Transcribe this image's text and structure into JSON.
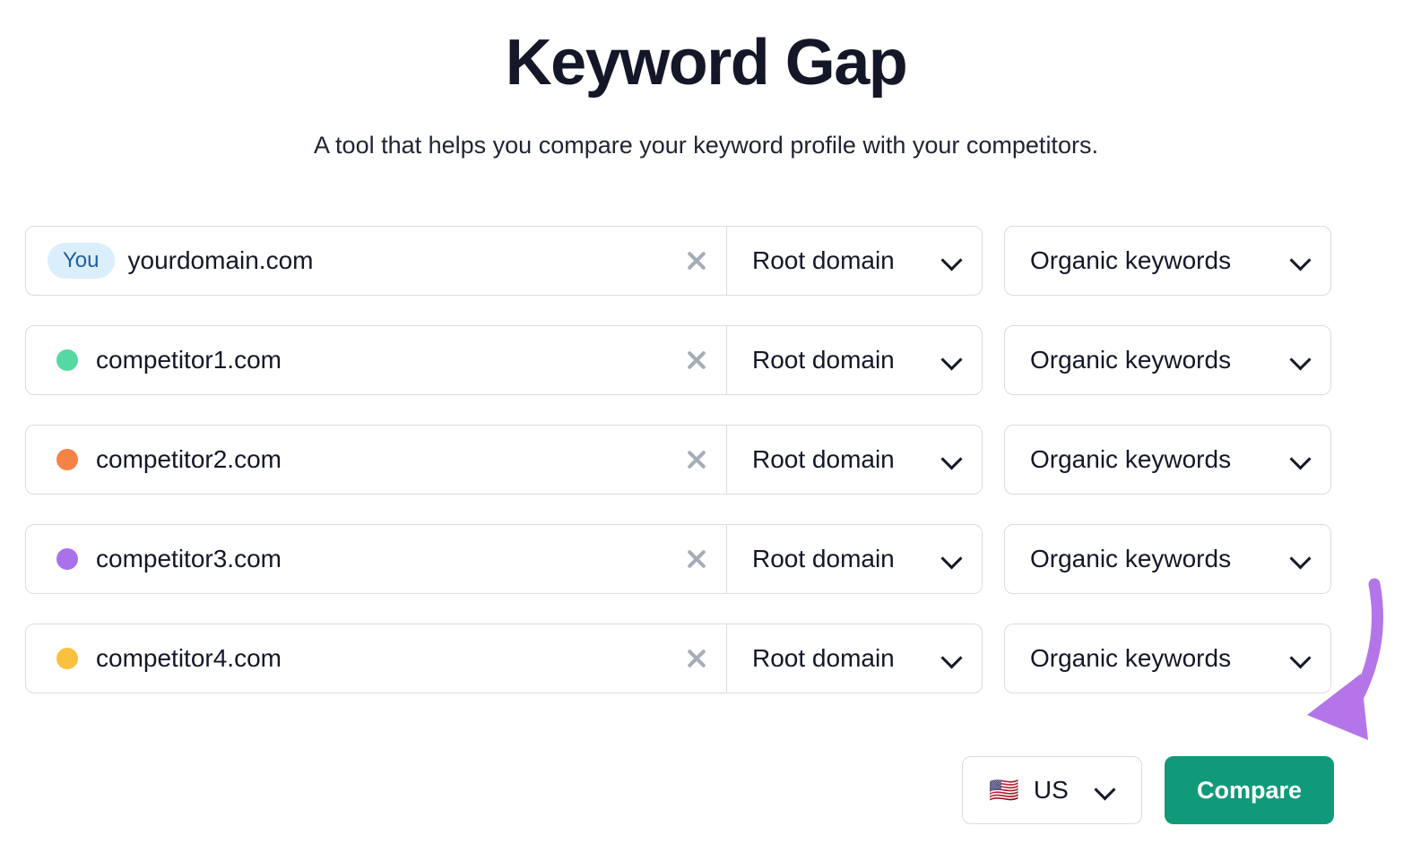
{
  "header": {
    "title": "Keyword Gap",
    "subtitle": "A tool that helps you compare your keyword profile with your competitors."
  },
  "rows": [
    {
      "badge_label": "You",
      "badge_type": "you",
      "domain": "yourdomain.com",
      "clear_icon": "close-icon",
      "scope_label": "Root domain",
      "metric_label": "Organic keywords"
    },
    {
      "dot_color": "#55d9a3",
      "badge_type": "dot",
      "domain": "competitor1.com",
      "clear_icon": "close-icon",
      "scope_label": "Root domain",
      "metric_label": "Organic keywords"
    },
    {
      "dot_color": "#f58345",
      "badge_type": "dot",
      "domain": "competitor2.com",
      "clear_icon": "close-icon",
      "scope_label": "Root domain",
      "metric_label": "Organic keywords"
    },
    {
      "dot_color": "#a971ec",
      "badge_type": "dot",
      "domain": "competitor3.com",
      "clear_icon": "close-icon",
      "scope_label": "Root domain",
      "metric_label": "Organic keywords"
    },
    {
      "dot_color": "#f9c13c",
      "badge_type": "dot",
      "domain": "competitor4.com",
      "clear_icon": "close-icon",
      "scope_label": "Root domain",
      "metric_label": "Organic keywords"
    }
  ],
  "footer": {
    "country_flag": "🇺🇸",
    "country_label": "US",
    "compare_label": "Compare"
  },
  "annotation": {
    "type": "curved-arrow",
    "color": "#b375e8",
    "points_to": "compare-button"
  },
  "colors": {
    "accent_teal": "#119a7a",
    "badge_bg": "#dbeefb",
    "badge_text": "#1f5d9e",
    "border": "#d9dce3",
    "text": "#141728",
    "clear_icon": "#a6abb8",
    "annotation": "#b375e8"
  }
}
